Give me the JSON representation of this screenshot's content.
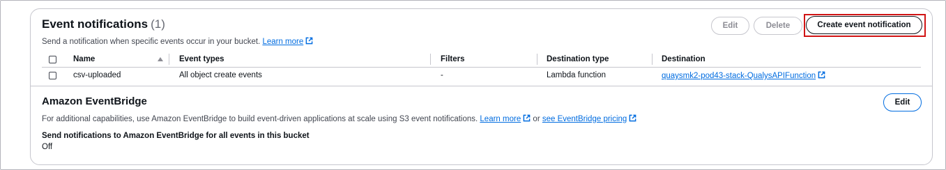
{
  "event_notifications": {
    "title": "Event notifications",
    "count": "(1)",
    "description": "Send a notification when specific events occur in your bucket.",
    "learn_more": "Learn more",
    "buttons": {
      "edit": "Edit",
      "delete": "Delete",
      "create": "Create event notification"
    },
    "table": {
      "columns": [
        "Name",
        "Event types",
        "Filters",
        "Destination type",
        "Destination"
      ],
      "rows": [
        {
          "name": "csv-uploaded",
          "event_types": "All object create events",
          "filters": "-",
          "destination_type": "Lambda function",
          "destination": "quaysmk2-pod43-stack-QualysAPIFunction"
        }
      ]
    }
  },
  "eventbridge": {
    "title": "Amazon EventBridge",
    "edit": "Edit",
    "description": "For additional capabilities, use Amazon EventBridge to build event-driven applications at scale using S3 event notifications.",
    "learn_more": "Learn more",
    "or_text": "or",
    "pricing_link": "see EventBridge pricing",
    "setting_label": "Send notifications to Amazon EventBridge for all events in this bucket",
    "setting_value": "Off"
  },
  "icons": {
    "external_link": "external-link-icon",
    "sort": "sort-ascending-icon"
  },
  "colors": {
    "link": "#006ce0",
    "highlight": "#d11414",
    "border": "#c6c6cd"
  }
}
